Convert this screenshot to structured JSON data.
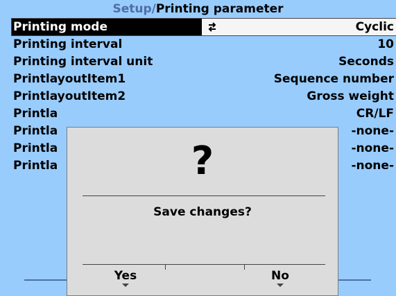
{
  "header": {
    "path": "Setup/",
    "current": "Printing parameter"
  },
  "rows": [
    {
      "label": "Printing mode",
      "value": "Cyclic",
      "selected": true
    },
    {
      "label": "Printing interval",
      "value": "10"
    },
    {
      "label": "Printing interval unit",
      "value": "Seconds"
    },
    {
      "label": "PrintlayoutItem1",
      "value": "Sequence number"
    },
    {
      "label": "PrintlayoutItem2",
      "value": "Gross weight"
    },
    {
      "label": "Printla",
      "value": "CR/LF"
    },
    {
      "label": "Printla",
      "value": "-none-"
    },
    {
      "label": "Printla",
      "value": "-none-"
    },
    {
      "label": "Printla",
      "value": "-none-"
    }
  ],
  "dialog": {
    "icon": "?",
    "message": "Save changes?",
    "yes_label": "Yes",
    "no_label": "No"
  },
  "colors": {
    "background": "#98CCFC",
    "header_path": "#4E6FA8",
    "dialog_bg": "#DCDCDC",
    "selected_label_bg": "#000000"
  },
  "icons": {
    "edit": "up-down-arrows-icon",
    "softkey": "triangle-down-icon"
  }
}
